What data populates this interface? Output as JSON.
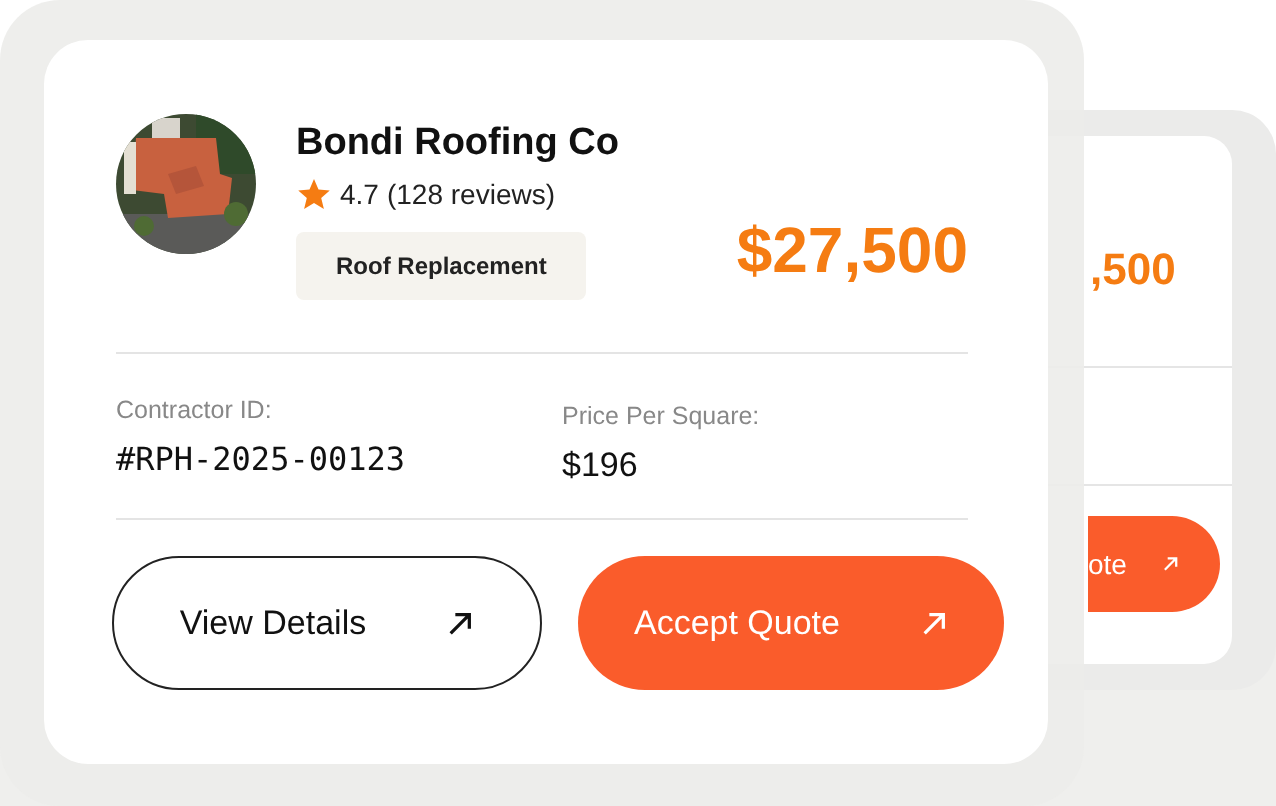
{
  "back_card": {
    "price": ",500",
    "button": {
      "label": "ote"
    }
  },
  "card": {
    "name": "Bondi Roofing Co",
    "rating": "4.7",
    "reviews": "(128 reviews)",
    "service_tag": "Roof Replacement",
    "price": "$27,500",
    "details": [
      {
        "label": "Contractor ID:",
        "value": "#RPH-2025-00123"
      },
      {
        "label": "Price Per Square:",
        "value": "$196"
      }
    ],
    "buttons": [
      {
        "label": "View Details",
        "kind": "outline"
      },
      {
        "label": "Accept Quote",
        "kind": "primary"
      }
    ]
  }
}
